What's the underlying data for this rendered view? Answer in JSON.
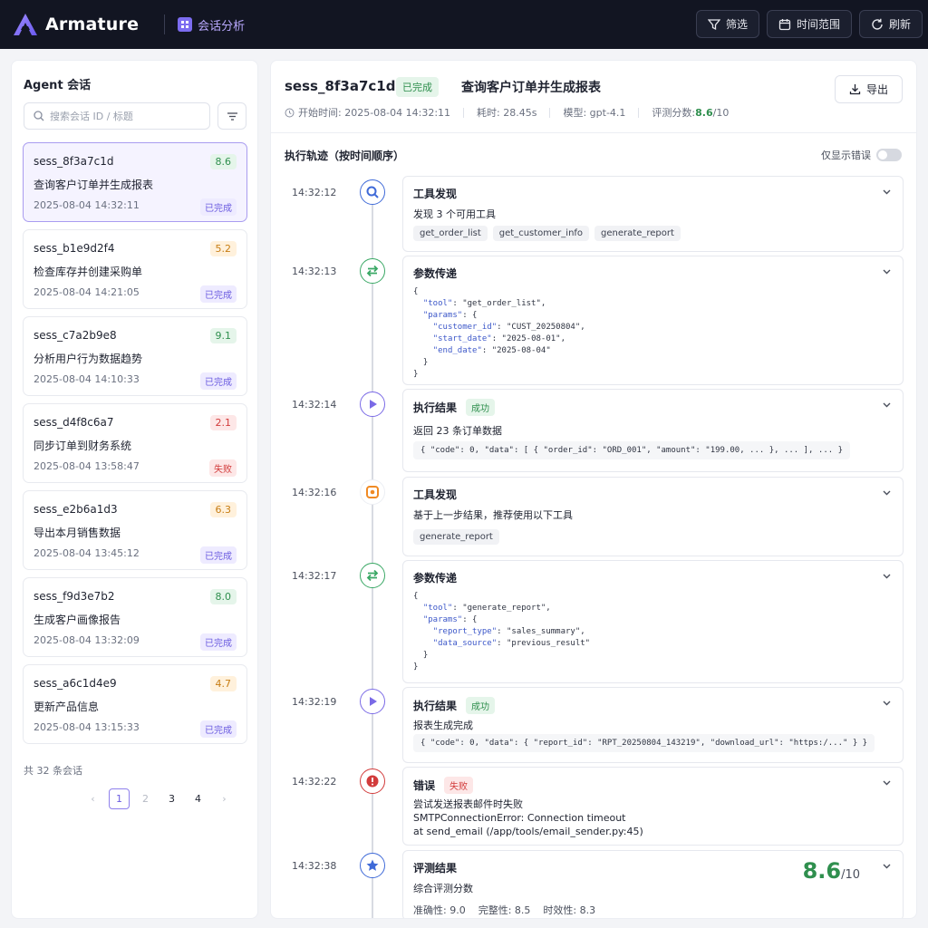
{
  "app": {
    "name": "Armature",
    "section": "会话分析"
  },
  "toolbar": {
    "filter_label": "筛选",
    "time_range_label": "时间范围",
    "refresh_label": "刷新"
  },
  "left": {
    "title": "Agent 会话",
    "search_placeholder": "搜索会话 ID / 标题",
    "sessions": [
      {
        "id": "sess_8f3a7c1d",
        "title": "查询客户订单并生成报表",
        "time": "2025-08-04 14:32:11",
        "score": "8.6",
        "status": "已完成"
      },
      {
        "id": "sess_b1e9d2f4",
        "title": "检查库存并创建采购单",
        "time": "2025-08-04 14:21:05",
        "score": "5.2",
        "status": "已完成"
      },
      {
        "id": "sess_c7a2b9e8",
        "title": "分析用户行为数据趋势",
        "time": "2025-08-04 14:10:33",
        "score": "9.1",
        "status": "已完成"
      },
      {
        "id": "sess_d4f8c6a7",
        "title": "同步订单到财务系统",
        "time": "2025-08-04 13:58:47",
        "score": "2.1",
        "status": "失败"
      },
      {
        "id": "sess_e2b6a1d3",
        "title": "导出本月销售数据",
        "time": "2025-08-04 13:45:12",
        "score": "6.3",
        "status": "已完成"
      },
      {
        "id": "sess_f9d3e7b2",
        "title": "生成客户画像报告",
        "time": "2025-08-04 13:32:09",
        "score": "8.0",
        "status": "已完成"
      },
      {
        "id": "sess_a6c1d4e9",
        "title": "更新产品信息",
        "time": "2025-08-04 13:15:33",
        "score": "4.7",
        "status": "已完成"
      }
    ],
    "total": "共 32 条会话",
    "pages": [
      "1",
      "2",
      "3",
      "4"
    ],
    "prev": "‹",
    "next": "›"
  },
  "detail": {
    "id": "sess_8f3a7c1d",
    "status": "已完成",
    "title": "查询客户订单并生成报表",
    "export_label": "导出",
    "start_time": "开始时间: 2025-08-04 14:32:11",
    "duration": "耗时: 28.45s",
    "model": "模型: gpt-4.1",
    "score_label": "评测分数: ",
    "score_value": "8.6",
    "score_max": "/10",
    "trace_title": "执行轨迹（按时间顺序）",
    "errors_only_label": "仅显示错误",
    "steps": [
      {
        "time": "14:32:12",
        "title": "工具发现",
        "desc": "发现 3 个可用工具",
        "tools": [
          "get_order_list",
          "get_customer_info",
          "generate_report"
        ]
      },
      {
        "time": "14:32:13",
        "title": "参数传递"
      },
      {
        "time": "14:32:14",
        "title": "执行结果",
        "tag": "成功",
        "desc": "返回 23 条订单数据",
        "result": "{ \"code\": 0, \"data\": [ { \"order_id\": \"ORD_001\", \"amount\": \"199.00, ... }, ... ], ... }"
      },
      {
        "time": "14:32:16",
        "title": "工具发现",
        "desc": "基于上一步结果，推荐使用以下工具",
        "tools": [
          "generate_report"
        ]
      },
      {
        "time": "14:32:17",
        "title": "参数传递"
      },
      {
        "time": "14:32:19",
        "title": "执行结果",
        "tag": "成功",
        "desc": "报表生成完成",
        "result": "{ \"code\": 0, \"data\": { \"report_id\": \"RPT_20250804_143219\", \"download_url\": \"https:/...\" } }"
      },
      {
        "time": "14:32:22",
        "title": "错误",
        "tag": "失败",
        "lines": [
          "尝试发送报表邮件时失败",
          "SMTPConnectionError: Connection timeout",
          "at send_email (/app/tools/email_sender.py:45)"
        ]
      },
      {
        "time": "14:32:38",
        "title": "评测结果",
        "desc": "综合评测分数",
        "score": "8.6",
        "max": "/10",
        "accuracy": "准确性: 9.0",
        "completeness": "完整性: 8.5",
        "timeliness": "时效性: 8.3"
      }
    ]
  },
  "colors": {
    "accent": "#7c6cf0",
    "success": "#2f8f4e",
    "error": "#d23b3b",
    "topbar": "#121522"
  }
}
